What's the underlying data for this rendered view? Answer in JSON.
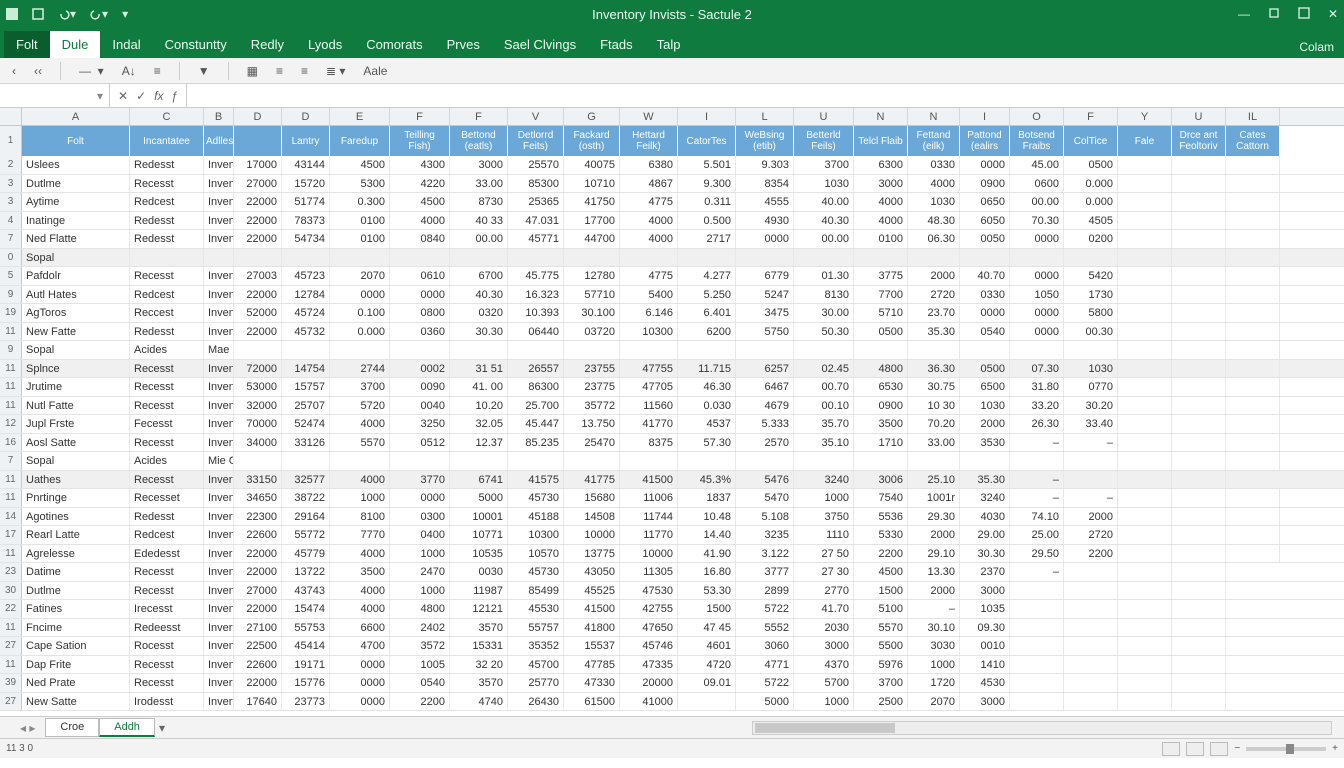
{
  "title": "Inventory Invists - Sactule 2",
  "qat": [
    "save",
    "undo",
    "redo",
    "dropdown"
  ],
  "ribbon_right": "Colam",
  "tabs": [
    "Folt",
    "Dule",
    "Indal",
    "Constuntty",
    "Redly",
    "Lyods",
    "Comorats",
    "Prves",
    "Sael Clvings",
    "Ftads",
    "Talp"
  ],
  "active_tab": 1,
  "ribbon_items": [
    "paste",
    "font",
    "align",
    "merge"
  ],
  "ribbon_label": "Aale",
  "name_box": "",
  "status_left": "11 3 0",
  "col_letters": [
    "A",
    "C",
    "B",
    "D",
    "D",
    "E",
    "F",
    "F",
    "V",
    "G",
    "W",
    "I",
    "L",
    "U",
    "N",
    "N",
    "I",
    "O",
    "F",
    "Y",
    "U",
    "IL"
  ],
  "col_widths": [
    "w-a",
    "w-b",
    "w-c",
    "w-d",
    "w-e",
    "w-f",
    "w-g",
    "w-h",
    "w-i",
    "w-j",
    "w-k",
    "w-l",
    "w-m",
    "w-n",
    "w-o",
    "w-p",
    "w-q",
    "w-r",
    "w-s",
    "w-t",
    "w-u",
    "w-v",
    "w-w",
    "w-x",
    "w-y",
    "w-z"
  ],
  "headers": [
    "Folt",
    "Incantatee",
    "Adlles",
    "",
    "Lantry",
    "Faredup",
    "Teilling Fish)",
    "Bettond (eatls)",
    "Detlorrd Feits)",
    "Fackard (osth)",
    "Hettard Feilk)",
    "CatorTes",
    "WeBsing (etib)",
    "Betterld Feils)",
    "Telcl Flaib",
    "Fettand (eilk)",
    "Pattond (ealirs",
    "Botsend Fraibs",
    "ColTice",
    "Fale",
    "Drce ant Feoltoriv",
    "Cates Cattorn"
  ],
  "row_nums": [
    "1",
    "2",
    "3",
    "3",
    "4",
    "7",
    "0",
    "5",
    "9",
    "19",
    "11",
    "9",
    "11",
    "11",
    "11",
    "12",
    "16",
    "7",
    "11",
    "11",
    "14",
    "17",
    "11",
    "23",
    "30",
    "22",
    "11",
    "27",
    "11",
    "39",
    "27"
  ],
  "shaded": [
    6,
    12,
    18
  ],
  "rows": [
    [
      "Uslees",
      "Redesst",
      "Inventy; Uop",
      "17000",
      "43144",
      "4500",
      "4300",
      "3000",
      "25570",
      "40075",
      "6380",
      "5.501",
      "9.303",
      "3700",
      "6300",
      "0330",
      "0000",
      "45.00",
      "0500",
      "",
      "",
      ""
    ],
    [
      "Dutlme",
      "Recesst",
      "Inventy; Tlop",
      "27000",
      "15720",
      "5300",
      "4220",
      "33.00",
      "85300",
      "10710",
      "4867",
      "9.300",
      "8354",
      "1030",
      "3000",
      "4000",
      "0900",
      "0600",
      "0.000",
      "",
      "",
      ""
    ],
    [
      "Aytime",
      "Redcest",
      "Inventy; Hop",
      "22000",
      "51774",
      "0.300",
      "4500",
      "8730",
      "25365",
      "41750",
      "4775",
      "0.311",
      "4555",
      "40.00",
      "4000",
      "1030",
      "0650",
      "00.00",
      "0.000",
      "",
      "",
      ""
    ],
    [
      "Inatinge",
      "Redesst",
      "Inventy; Hop",
      "22000",
      "78373",
      "0100",
      "4000",
      "40 33",
      "47.031",
      "17700",
      "4000",
      "0.500",
      "4930",
      "40.30",
      "4000",
      "48.30",
      "6050",
      "70.30",
      "4505",
      "",
      "",
      ""
    ],
    [
      "Ned Flatte",
      "Redesst",
      "Inventy; Uop",
      "22000",
      "54734",
      "0100",
      "0840",
      "00.00",
      "45771",
      "44700",
      "4000",
      "2717",
      "0000",
      "00.00",
      "0100",
      "06.30",
      "0050",
      "0000",
      "0200",
      "",
      "",
      ""
    ],
    [
      "Sopal",
      "",
      "",
      "",
      "",
      "",
      "",
      "",
      "",
      "",
      "",
      "",
      "",
      "",
      "",
      "",
      "",
      "",
      "",
      "",
      "",
      ""
    ],
    [
      "Pafdolr",
      "Recesst",
      "Inventy; Tlop",
      "27003",
      "45723",
      "2070",
      "0610",
      "6700",
      "45.775",
      "12780",
      "4775",
      "4.277",
      "6779",
      "01.30",
      "3775",
      "2000",
      "40.70",
      "0000",
      "5420",
      "",
      "",
      ""
    ],
    [
      "Autl Hates",
      "Redcest",
      "Inventy; Hop",
      "22000",
      "12784",
      "0000",
      "0000",
      "40.30",
      "16.323",
      "57710",
      "5400",
      "5.250",
      "5247",
      "8130",
      "7700",
      "2720",
      "0330",
      "1050",
      "1730",
      "",
      "",
      ""
    ],
    [
      "AgToros",
      "Reccest",
      "Inventy; Hop",
      "52000",
      "45724",
      "0.100",
      "0800",
      "0320",
      "10.393",
      "30.100",
      "6.146",
      "6.401",
      "3475",
      "30.00",
      "5710",
      "23.70",
      "0000",
      "0000",
      "5800",
      "",
      "",
      ""
    ],
    [
      "New Fatte",
      "Redesst",
      "Inventy; Hop",
      "22000",
      "45732",
      "0.000",
      "0360",
      "30.30",
      "06440",
      "03720",
      "10300",
      "6200",
      "5750",
      "50.30",
      "0500",
      "35.30",
      "0540",
      "0000",
      "00.30",
      "",
      "",
      ""
    ],
    [
      "Sopal",
      "Acides",
      "Mae    Uopl",
      "",
      "",
      "",
      "",
      "",
      "",
      "",
      "",
      "",
      "",
      "",
      "",
      "",
      "",
      "",
      "",
      "",
      "",
      ""
    ],
    [
      "Splnce",
      "Recesst",
      "Inventy; Eop",
      "72000",
      "14754",
      "2744",
      "0002",
      "31 51",
      "26557",
      "23755",
      "47755",
      "11.715",
      "6257",
      "02.45",
      "4800",
      "36.30",
      "0500",
      "07.30",
      "1030",
      "",
      "",
      ""
    ],
    [
      "Jrutime",
      "Recesst",
      "Inventy; Top",
      "53000",
      "15757",
      "3700",
      "0090",
      "41. 00",
      "86300",
      "23775",
      "47705",
      "46.30",
      "6467",
      "00.70",
      "6530",
      "30.75",
      "6500",
      "31.80",
      "0770",
      "",
      "",
      ""
    ],
    [
      "Nutl Fatte",
      "Recesst",
      "Inventy; Hop",
      "32000",
      "25707",
      "5720",
      "0040",
      "10.20",
      "25.700",
      "35772",
      "11560",
      "0.030",
      "4679",
      "00.10",
      "0900",
      "10 30",
      "1030",
      "33.20",
      "30.20",
      "",
      "",
      ""
    ],
    [
      "Jupl Frste",
      "Fecesst",
      "Inventy; Tlop",
      "70000",
      "52474",
      "4000",
      "3250",
      "32.05",
      "45.447",
      "13.750",
      "41770",
      "4537",
      "5.333",
      "35.70",
      "3500",
      "70.20",
      "2000",
      "26.30",
      "33.40",
      "",
      "",
      ""
    ],
    [
      "Aosl Satte",
      "Recesst",
      "Inventy; Hop",
      "34000",
      "33126",
      "5570",
      "0512",
      "12.37",
      "85.235",
      "25470",
      "8375",
      "57.30",
      "2570",
      "35.10",
      "1710",
      "33.00",
      "3530",
      "–",
      "–",
      "",
      "",
      ""
    ],
    [
      "Sopal",
      "Acides",
      "Mie    Gopl",
      "",
      "",
      "",
      "",
      "",
      "",
      "",
      "",
      "",
      "",
      "",
      "",
      "",
      "",
      "",
      "",
      "",
      "",
      ""
    ],
    [
      "Uathes",
      "Recesst",
      "Inverty; Lop",
      "33150",
      "32577",
      "4000",
      "3770",
      "6741",
      "41575",
      "41775",
      "41500",
      "45.3%",
      "5476",
      "3240",
      "3006",
      "25.10",
      "35.30",
      "–",
      "",
      "",
      ""
    ],
    [
      "Pnrtinge",
      "Recesset",
      "Inventy; Hop",
      "34650",
      "38722",
      "1000",
      "0000",
      "5000",
      "45730",
      "15680",
      "11006",
      "1837",
      "5470",
      "1000",
      "7540",
      "1001r",
      "3240",
      "–",
      "–",
      "",
      "",
      ""
    ],
    [
      "Agotines",
      "Redesst",
      "Inverty; Hop",
      "22300",
      "29164",
      "8100",
      "0300",
      "10001",
      "45188",
      "14508",
      "11744",
      "10.48",
      "5.108",
      "3750",
      "5536",
      "29.30",
      "4030",
      "74.10",
      "2000",
      "",
      "",
      ""
    ],
    [
      "Rearl Latte",
      "Redcest",
      "Inventy; Upp",
      "22600",
      "55772",
      "7770",
      "0400",
      "10771",
      "10300",
      "10000",
      "11770",
      "14.40",
      "3235",
      "1110",
      "5330",
      "2000",
      "29.00",
      "25.00",
      "2720",
      "",
      "",
      ""
    ],
    [
      "Agrelesse",
      "Ededesst",
      "Invernty; Hop",
      "22000",
      "45779",
      "4000",
      "1000",
      "10535",
      "10570",
      "13775",
      "10000",
      "41.90",
      "3.122",
      "27 50",
      "2200",
      "29.10",
      "30.30",
      "29.50",
      "2200",
      "",
      "",
      ""
    ],
    [
      "Datime",
      "Recesst",
      "Inventy; Hop",
      "22000",
      "13722",
      "3500",
      "2470",
      "0030",
      "45730",
      "43050",
      "11305",
      "16.80",
      "3777",
      "27 30",
      "4500",
      "13.30",
      "2370",
      "–",
      "",
      "",
      ""
    ],
    [
      "Dutlme",
      "Recesst",
      "Inventy; Uop",
      "27000",
      "43743",
      "4000",
      "1000",
      "11987",
      "85499",
      "45525",
      "47530",
      "53.30",
      "2899",
      "2770",
      "1500",
      "2000",
      "3000",
      "",
      "",
      "",
      ""
    ],
    [
      "Fatines",
      "Irecesst",
      "Inventy; Uop",
      "22000",
      "15474",
      "4000",
      "4800",
      "12121",
      "45530",
      "41500",
      "42755",
      "1500",
      "5722",
      "41.70",
      "5100",
      "–",
      "1035",
      "",
      "",
      "",
      ""
    ],
    [
      "Fncime",
      "Redeesst",
      "Inverty; Lop",
      "27100",
      "55753",
      "6600",
      "2402",
      "3570",
      "55757",
      "41800",
      "47650",
      "47 45",
      "5552",
      "2030",
      "5570",
      "30.10",
      "09.30",
      "",
      "",
      "",
      ""
    ],
    [
      "Cape Sation",
      "Rocesst",
      "Inventy; Uop",
      "22500",
      "45414",
      "4700",
      "3572",
      "15331",
      "35352",
      "15537",
      "45746",
      "4601",
      "3060",
      "3000",
      "5500",
      "3030",
      "0010",
      "",
      "",
      "",
      ""
    ],
    [
      "Dap Frite",
      "Recesst",
      "Inventy; Hop",
      "22600",
      "19171",
      "0000",
      "1005",
      "32 20",
      "45700",
      "47785",
      "47335",
      "4720",
      "4771",
      "4370",
      "5976",
      "1000",
      "1410",
      "",
      "",
      "",
      ""
    ],
    [
      "Ned Prate",
      "Recesst",
      "Inverty; Hop",
      "22000",
      "15776",
      "0000",
      "0540",
      "3570",
      "25770",
      "47330",
      "20000",
      "09.01",
      "5722",
      "5700",
      "3700",
      "1720",
      "4530",
      "",
      "",
      "",
      ""
    ],
    [
      "New Satte",
      "Irodesst",
      "Inverty; Hop",
      "17640",
      "23773",
      "0000",
      "2200",
      "4740",
      "26430",
      "61500",
      "41000",
      "",
      "5000",
      "1000",
      "2500",
      "2070",
      "3000",
      "",
      "",
      "",
      ""
    ]
  ],
  "sheets": [
    "Croe",
    "Addh"
  ],
  "active_sheet": 1
}
